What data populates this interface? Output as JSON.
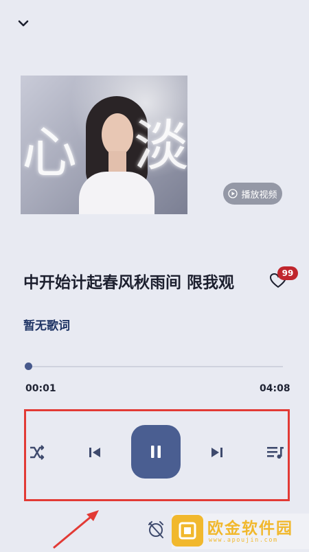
{
  "cover": {
    "overlay_text_left": "心",
    "overlay_text_right": "淡"
  },
  "play_video_label": "播放视频",
  "song": {
    "title": "中开始计起春风秋雨间 限我观"
  },
  "like": {
    "count": "99"
  },
  "lyrics_label": "暂无歌词",
  "progress": {
    "current": "00:01",
    "total": "04:08",
    "fraction": 0.004
  },
  "controls": [
    "shuffle-icon",
    "skip-previous-icon",
    "pause-icon",
    "skip-next-icon",
    "playlist-icon"
  ],
  "accent_color": "#4a5e91",
  "annotation_color": "#e23a35",
  "watermark": {
    "name": "欧金软件园",
    "site": "www.apoujin.com"
  }
}
